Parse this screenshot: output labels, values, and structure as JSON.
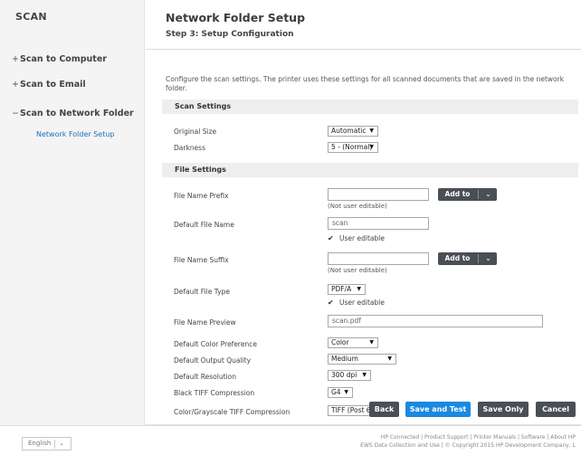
{
  "sidebar": {
    "title": "SCAN",
    "items": [
      {
        "mark": "+",
        "label": "Scan to Computer"
      },
      {
        "mark": "+",
        "label": "Scan to Email"
      },
      {
        "mark": "−",
        "label": "Scan to Network Folder"
      }
    ],
    "sub_item": "Network Folder Setup"
  },
  "header": {
    "title": "Network Folder Setup",
    "step": "Step 3: Setup Configuration"
  },
  "intro": "Configure the scan settings. The printer uses these settings for all scanned documents that are saved in the network folder.",
  "scan_settings": {
    "heading": "Scan Settings",
    "original_size": {
      "label": "Original Size",
      "value": "Automatic"
    },
    "darkness": {
      "label": "Darkness",
      "value": "5 - (Normal)"
    }
  },
  "file_settings": {
    "heading": "File Settings",
    "prefix": {
      "label": "File Name Prefix",
      "value": "",
      "note": "(Not user editable)",
      "add_label": "Add to"
    },
    "default_name": {
      "label": "Default File Name",
      "value": "scan",
      "checkbox": "User editable"
    },
    "suffix": {
      "label": "File Name Suffix",
      "value": "",
      "note": "(Not user editable)",
      "add_label": "Add to"
    },
    "file_type": {
      "label": "Default File Type",
      "value": "PDF/A",
      "checkbox": "User editable"
    },
    "preview": {
      "label": "File Name Preview",
      "value": "scan.pdf"
    },
    "color_pref": {
      "label": "Default Color Preference",
      "value": "Color"
    },
    "output_quality": {
      "label": "Default Output Quality",
      "value": "Medium"
    },
    "resolution": {
      "label": "Default Resolution",
      "value": "300 dpi"
    },
    "bw_tiff": {
      "label": "Black TIFF Compression",
      "value": "G4"
    },
    "color_tiff": {
      "label": "Color/Grayscale TIFF Compression",
      "value": "TIFF (Post 6.0)"
    }
  },
  "actions": {
    "back": "Back",
    "save_test": "Save and Test",
    "save_only": "Save Only",
    "cancel": "Cancel"
  },
  "footer": {
    "language": "English",
    "links": [
      "HP Connected",
      "Product Support",
      "Printer Manuals",
      "Software",
      "About HP"
    ],
    "copyright": "EWS Data Collection and Use | © Copyright 2015 HP Development Company, L"
  },
  "colors": {
    "accent": "#1a8ae0",
    "dark_button": "#4a4f55",
    "link": "#1e6fb8"
  }
}
